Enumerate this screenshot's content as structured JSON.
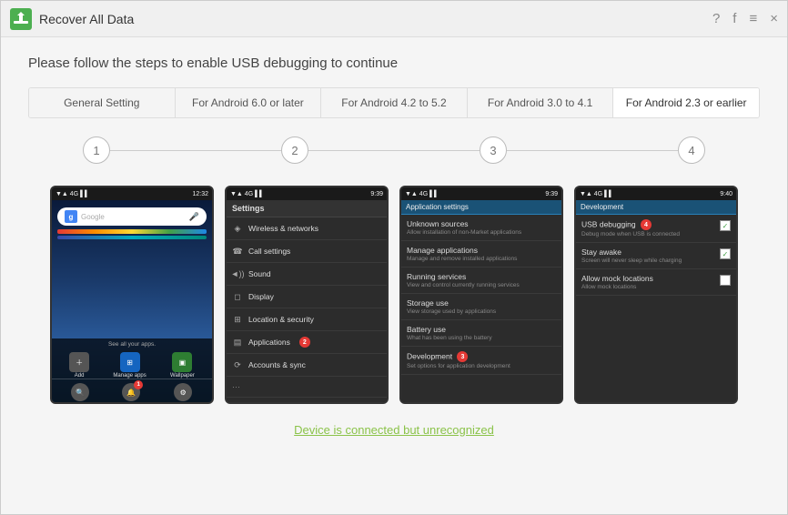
{
  "titleBar": {
    "title": "Recover All Data",
    "icons": {
      "help": "?",
      "facebook": "f",
      "menu": "≡",
      "close": "×"
    }
  },
  "instruction": "Please follow the steps to enable USB debugging to continue",
  "tabs": [
    {
      "id": "general",
      "label": "General Setting",
      "active": false
    },
    {
      "id": "android6",
      "label": "For Android 6.0 or later",
      "active": false
    },
    {
      "id": "android42",
      "label": "For Android 4.2 to 5.2",
      "active": false
    },
    {
      "id": "android30",
      "label": "For Android 3.0 to 4.1",
      "active": false
    },
    {
      "id": "android23",
      "label": "For Android 2.3 or earlier",
      "active": true
    }
  ],
  "steps": [
    "1",
    "2",
    "3",
    "4"
  ],
  "screens": {
    "screen1": {
      "statusLeft": "▼ ▲ 4G",
      "statusRight": "12:32",
      "searchPlaceholder": "Google",
      "apps": [
        {
          "label": "Add",
          "icon": "＋"
        },
        {
          "label": "Manage apps",
          "icon": "⊞"
        },
        {
          "label": "Wallpaper",
          "icon": "▣"
        }
      ],
      "bottomIcons": [
        {
          "label": "Search",
          "icon": "🔍",
          "badge": null
        },
        {
          "label": "Notifications",
          "icon": "🔔",
          "badge": "1"
        },
        {
          "label": "Settings",
          "icon": "⚙",
          "badge": null
        }
      ],
      "seeAllApps": "See all your apps."
    },
    "screen2": {
      "statusLeft": "▼ ▲ 4G",
      "statusRight": "9:39",
      "header": "Settings",
      "items": [
        {
          "icon": "◈",
          "label": "Wireless & networks"
        },
        {
          "icon": "☎",
          "label": "Call settings"
        },
        {
          "icon": "◄))",
          "label": "Sound"
        },
        {
          "icon": "◻",
          "label": "Display"
        },
        {
          "icon": "⊞",
          "label": "Location & security"
        },
        {
          "icon": "▤",
          "label": "Applications",
          "badge": "2"
        },
        {
          "icon": "⟳",
          "label": "Accounts & sync"
        },
        {
          "icon": "···",
          "label": ""
        }
      ]
    },
    "screen3": {
      "statusLeft": "▼ ▲ 4G",
      "statusRight": "9:39",
      "header": "Application settings",
      "items": [
        {
          "title": "Unknown sources",
          "desc": "Allow installation of non-Market applications"
        },
        {
          "title": "Manage applications",
          "desc": "Manage and remove installed applications"
        },
        {
          "title": "Running services",
          "desc": "View and control currently running services"
        },
        {
          "title": "Storage use",
          "desc": "View storage used by applications"
        },
        {
          "title": "Battery use",
          "desc": "What has been using the battery"
        },
        {
          "title": "Development",
          "desc": "Set options for application development",
          "badge": "3"
        }
      ]
    },
    "screen4": {
      "statusLeft": "▼ ▲ 4G",
      "statusRight": "9:40",
      "header": "Development",
      "items": [
        {
          "title": "USB debugging",
          "desc": "Debug mode when USB is connected",
          "badge": "4",
          "checked": true
        },
        {
          "title": "Stay awake",
          "desc": "Screen will never sleep while charging",
          "checked": true
        },
        {
          "title": "Allow mock locations",
          "desc": "Allow mock locations",
          "checked": false
        }
      ]
    }
  },
  "bottomLink": "Device is connected but unrecognized"
}
